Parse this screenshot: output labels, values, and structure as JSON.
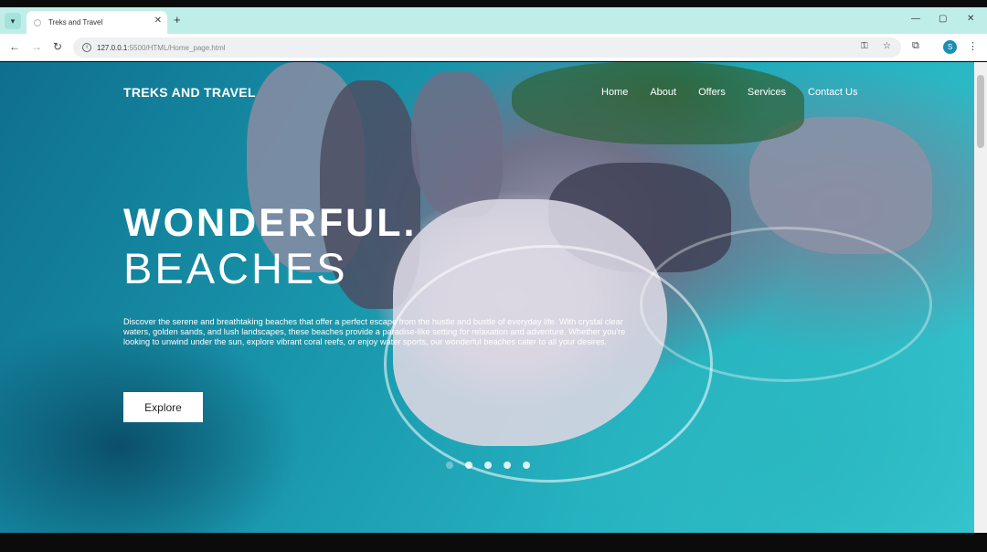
{
  "browser": {
    "tab_title": "Treks and Travel",
    "url_host": "127.0.0.1",
    "url_path": ":5500/HTML/Home_page.html",
    "new_tab_glyph": "+",
    "close_glyph": "✕",
    "minimize_glyph": "—",
    "maximize_glyph": "▢",
    "window_close_glyph": "✕",
    "profile_initial": "S"
  },
  "site": {
    "logo": "TREKS AND TRAVEL",
    "nav": [
      "Home",
      "About",
      "Offers",
      "Services",
      "Contact Us"
    ],
    "heading_line1": "WONDERFUL.",
    "heading_line2": "BEACHES",
    "description": "Discover the serene and breathtaking beaches that offer a perfect escape from the hustle and bustle of everyday life. With crystal clear waters, golden sands, and lush landscapes, these beaches provide a paradise-like setting for relaxation and adventure. Whether you're looking to unwind under the sun, explore vibrant coral reefs, or enjoy water sports, our wonderful beaches cater to all your desires.",
    "button_label": "Explore",
    "slider_dots": 5,
    "active_dot": 0
  },
  "colors": {
    "tabbar_bg": "#bfeee9",
    "ocean": "#1893a9",
    "button_bg": "#ffffff"
  }
}
